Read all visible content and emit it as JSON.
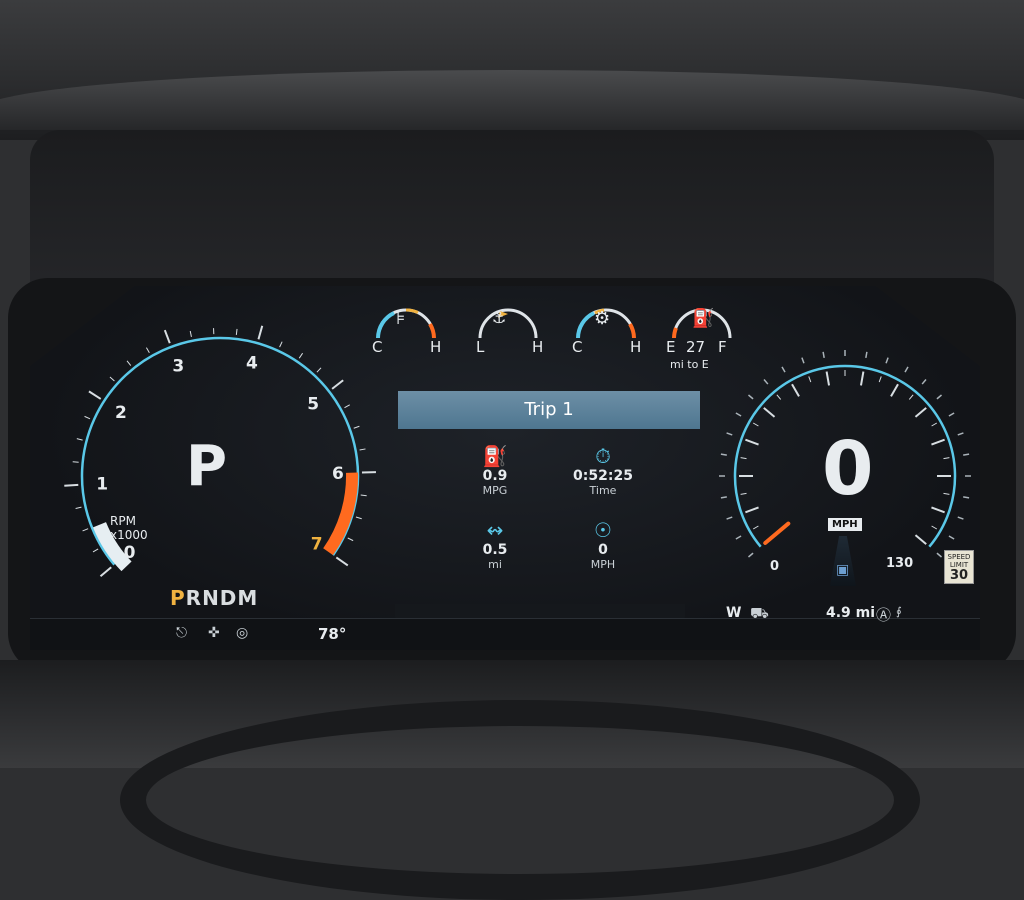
{
  "top_gauges": {
    "coolant": {
      "low": "C",
      "high": "H",
      "icon": "coolant-temperature-icon",
      "level": 0.3
    },
    "oil": {
      "low": "L",
      "high": "H",
      "icon": "oil-can-icon",
      "level": 0.5
    },
    "transmission": {
      "low": "C",
      "high": "H",
      "icon": "transmission-gear-icon",
      "level": 0.35
    },
    "fuel": {
      "low": "E",
      "high": "F",
      "icon": "fuel-pump-icon",
      "range_value": "27",
      "range_unit": "mi to E",
      "level": 0.05
    }
  },
  "tachometer": {
    "ticks": [
      "0",
      "1",
      "2",
      "3",
      "4",
      "5",
      "6",
      "7"
    ],
    "unit_line1": "RPM",
    "unit_line2": "x1000",
    "redline_color": "#ff6a1f",
    "rpm": 0
  },
  "gear": {
    "current": "P",
    "selector_selected": "P",
    "selector_rest": "RNDM"
  },
  "trip": {
    "title": "Trip 1",
    "stats": [
      {
        "value": "0.9",
        "label": "MPG",
        "icon": "fuel-economy-icon"
      },
      {
        "value": "0:52:25",
        "label": "Time",
        "icon": "stopwatch-icon"
      },
      {
        "value": "0.5",
        "label": "mi",
        "icon": "distance-route-icon"
      },
      {
        "value": "0",
        "label": "MPH",
        "icon": "average-speed-icon"
      }
    ]
  },
  "speedometer": {
    "value": "0",
    "unit": "MPH",
    "min_label": "0",
    "max_label": "130",
    "speed_limit_line1": "SPEED",
    "speed_limit_line2": "LIMIT",
    "speed_limit_value": "30"
  },
  "status": {
    "outside_temp": "78°",
    "compass": "W",
    "distance": "4.9 mi"
  },
  "colors": {
    "accent_blue": "#5ac8e8",
    "warning_orange": "#ff6a1f",
    "selector_yellow": "#f0b240"
  }
}
